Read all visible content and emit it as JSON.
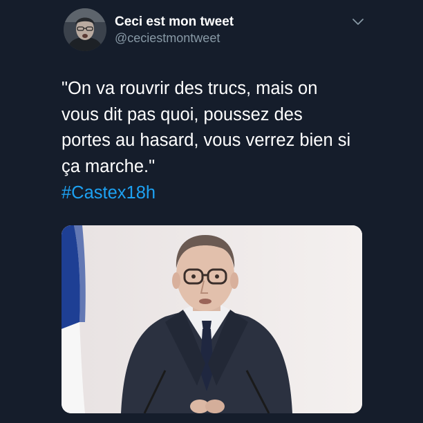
{
  "tweet": {
    "author": {
      "display_name": "Ceci est mon tweet",
      "handle": "@ceciestmontweet",
      "avatar_icon": "avatar-photo"
    },
    "menu_icon": "chevron-down-icon",
    "text_lines": [
      "\"On va rouvrir des trucs, mais on",
      "vous dit pas quoi, poussez des",
      "portes au hasard, vous verrez bien si",
      "ça marche.\""
    ],
    "hashtag": "#Castex18h",
    "media": {
      "type": "photo"
    }
  },
  "colors": {
    "background": "#151d2b",
    "text": "#ffffff",
    "secondary_text": "#8899a6",
    "link": "#1da1f2"
  }
}
